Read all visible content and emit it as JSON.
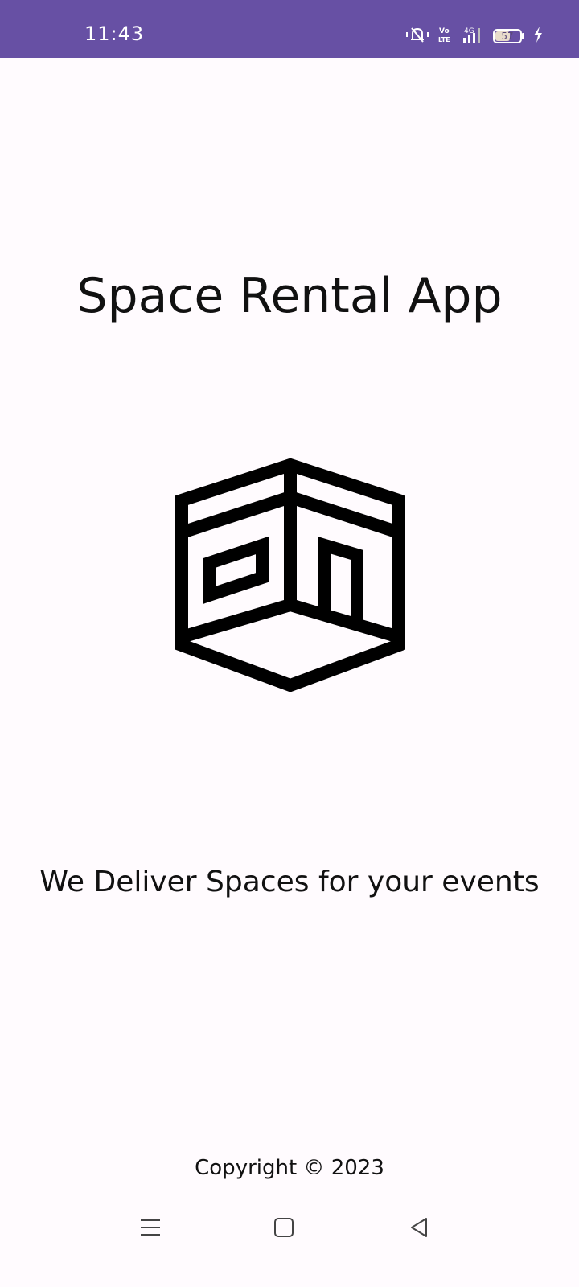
{
  "status_bar": {
    "time": "11:43",
    "battery_level": 57,
    "battery_label": "57",
    "network": "4G",
    "volte": "Vo LTE",
    "icons": [
      "vibrate-silent-icon",
      "volte-icon",
      "signal-4g-icon",
      "battery-icon",
      "charging-icon"
    ],
    "background_color": "#6750a4"
  },
  "app": {
    "title": "Space Rental App",
    "logo": "space-cube-logo",
    "tagline": "We Deliver Spaces for your events",
    "copyright": "Copyright © 2023"
  },
  "nav_bar": {
    "icons": [
      "menu-icon",
      "home-square-icon",
      "back-triangle-icon"
    ]
  }
}
